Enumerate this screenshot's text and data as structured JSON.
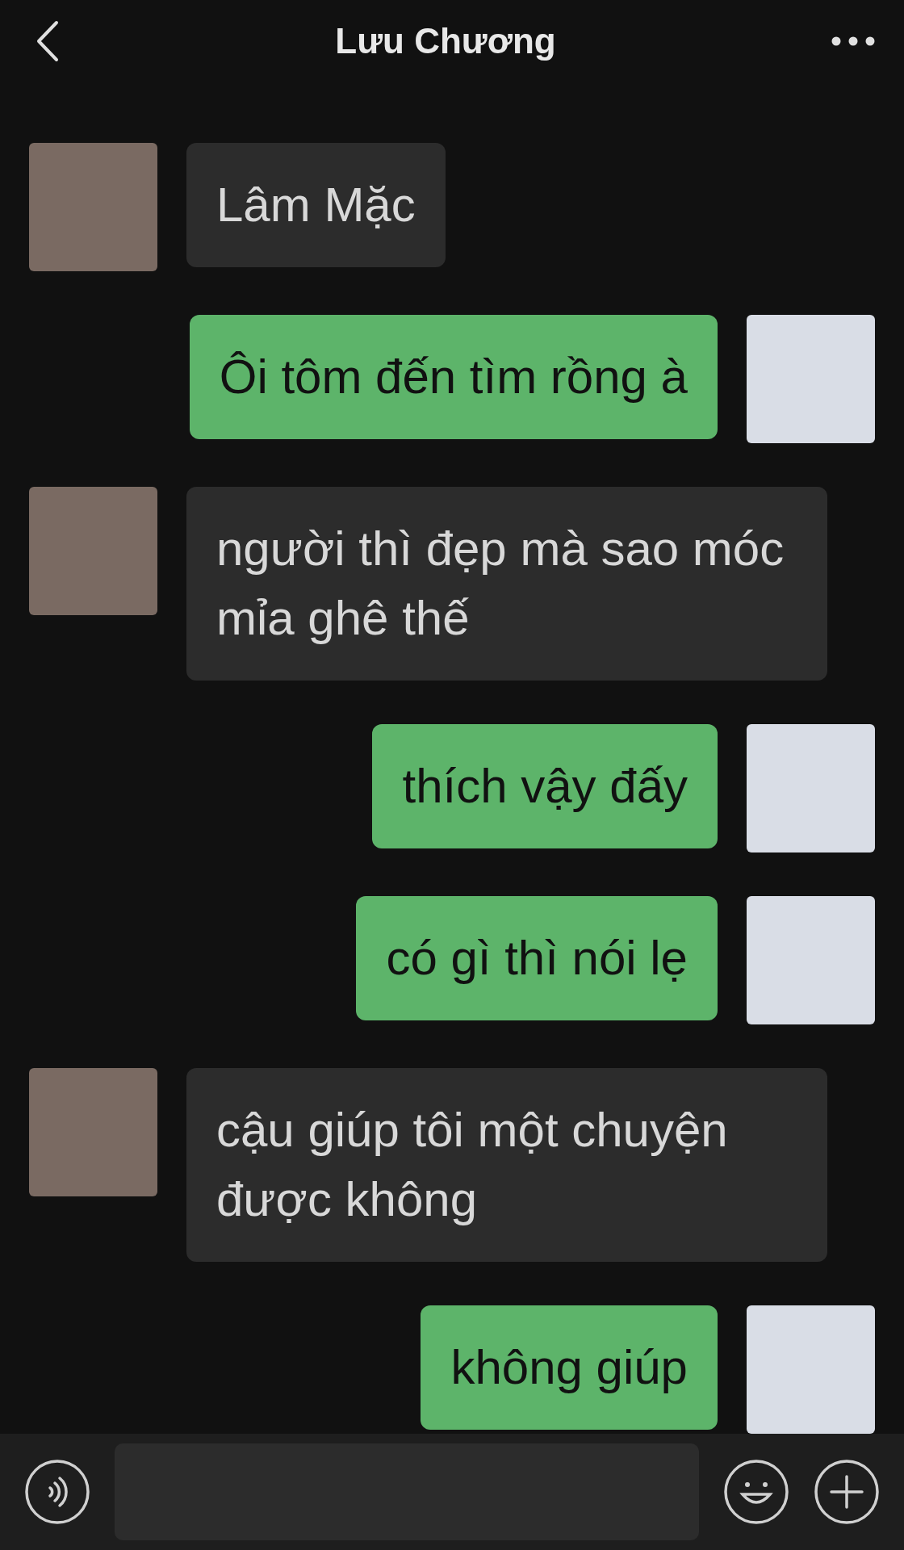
{
  "header": {
    "title": "Lưu Chương"
  },
  "messages": [
    {
      "kind": "received",
      "text": "Lâm Mặc"
    },
    {
      "kind": "sent",
      "text": "Ôi tôm đến tìm rồng à"
    },
    {
      "kind": "received",
      "text": "người thì đẹp mà sao móc mỉa ghê thế"
    },
    {
      "kind": "sent",
      "text": "thích vậy đấy"
    },
    {
      "kind": "sent",
      "text": "có gì thì nói lẹ"
    },
    {
      "kind": "received",
      "text": "cậu giúp tôi một chuyện được không"
    },
    {
      "kind": "sent",
      "text": "không giúp"
    }
  ]
}
